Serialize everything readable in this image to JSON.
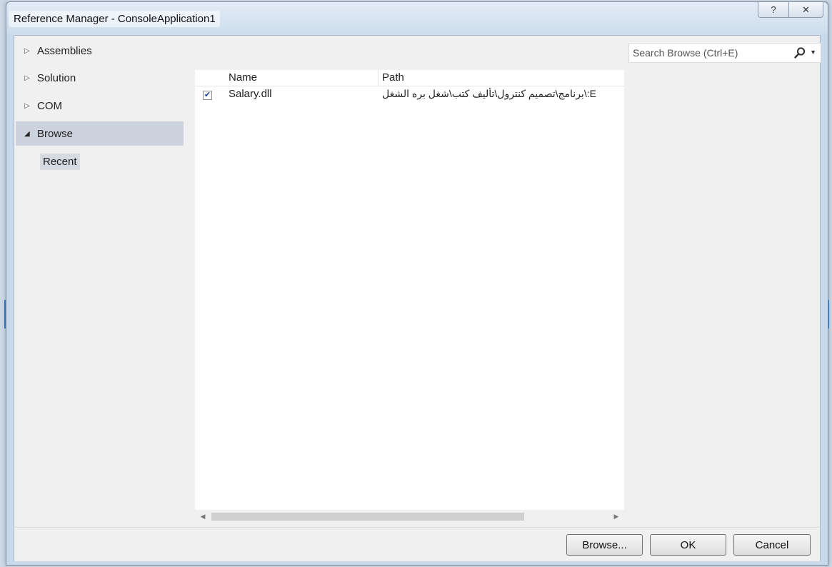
{
  "window": {
    "title": "Reference Manager - ConsoleApplication1",
    "help_glyph": "?",
    "close_glyph": "✕"
  },
  "sidebar": {
    "items": [
      {
        "label": "Assemblies",
        "expanded": false
      },
      {
        "label": "Solution",
        "expanded": false
      },
      {
        "label": "COM",
        "expanded": false
      },
      {
        "label": "Browse",
        "expanded": true,
        "selected": true
      }
    ],
    "collapsed_glyph": "▷",
    "expanded_glyph": "◢",
    "sub_items": [
      {
        "label": "Recent",
        "selected": true
      }
    ]
  },
  "list": {
    "columns": [
      "Name",
      "Path"
    ],
    "rows": [
      {
        "checked": true,
        "name": "Salary.dll",
        "path": "E:\\برنامج\\تصميم كنترول\\تأليف كتب\\شغل بره الشغل"
      }
    ],
    "check_glyph": "✔"
  },
  "search": {
    "placeholder": "Search Browse (Ctrl+E)",
    "value": ""
  },
  "scrollbar": {
    "left_glyph": "◀",
    "right_glyph": "▶"
  },
  "buttons": {
    "browse": "Browse...",
    "ok": "OK",
    "cancel": "Cancel"
  },
  "colors": {
    "accent": "#2b7fd3",
    "selection": "#ccd3de",
    "checkmark": "#1c3f94"
  }
}
